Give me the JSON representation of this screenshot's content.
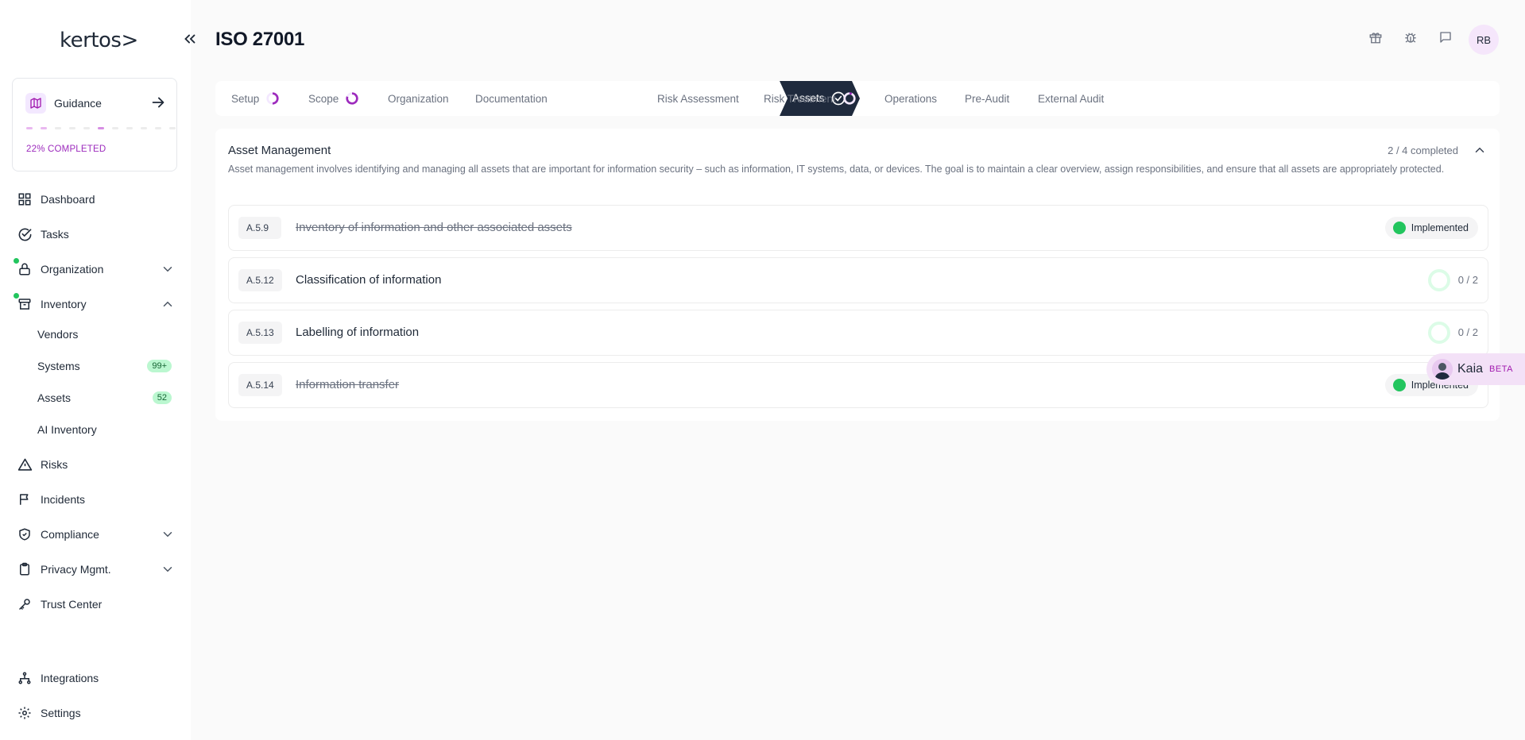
{
  "brand": {
    "logo_text": "kertos>"
  },
  "guidance": {
    "title": "Guidance",
    "progress_label": "22% COMPLETED",
    "progress_percent": 22
  },
  "nav": {
    "dashboard": "Dashboard",
    "tasks": "Tasks",
    "organization": "Organization",
    "inventory": "Inventory",
    "vendors": "Vendors",
    "systems": "Systems",
    "systems_badge": "99+",
    "assets": "Assets",
    "assets_badge": "52",
    "ai_inventory": "AI Inventory",
    "risks": "Risks",
    "incidents": "Incidents",
    "compliance": "Compliance",
    "privacy": "Privacy Mgmt.",
    "trust_center": "Trust Center",
    "integrations": "Integrations",
    "settings": "Settings"
  },
  "header": {
    "title": "ISO 27001",
    "user_initials": "RB"
  },
  "steps": {
    "setup": "Setup",
    "scope": "Scope",
    "organization": "Organization",
    "documentation": "Documentation",
    "assets": "Assets",
    "risk_assessment": "Risk Assessment",
    "risk_treatment": "Risk Treatment",
    "operations": "Operations",
    "pre_audit": "Pre-Audit",
    "external_audit": "External Audit"
  },
  "section": {
    "title": "Asset Management",
    "description": "Asset management involves identifying and managing all assets that are important for information security – such as information, IT systems, data, or devices. The goal is to maintain a clear overview, assign responsibilities, and ensure that all assets are appropriately protected.",
    "count": "2 / 4 completed",
    "controls": [
      {
        "id": "A.5.9",
        "name": "Inventory of information and other associated assets",
        "status": "Implemented"
      },
      {
        "id": "A.5.12",
        "name": "Classification of information",
        "progress": "0 / 2"
      },
      {
        "id": "A.5.13",
        "name": "Labelling of information",
        "progress": "0 / 2"
      },
      {
        "id": "A.5.14",
        "name": "Information transfer",
        "status": "Implemented"
      }
    ]
  },
  "assistant": {
    "name": "Kaia",
    "tag": "BETA"
  },
  "colors": {
    "accent": "#9d2bbd",
    "active_step": "#1f2a3d",
    "implemented": "#22c55e",
    "badge_bg": "#bbf7d0"
  }
}
